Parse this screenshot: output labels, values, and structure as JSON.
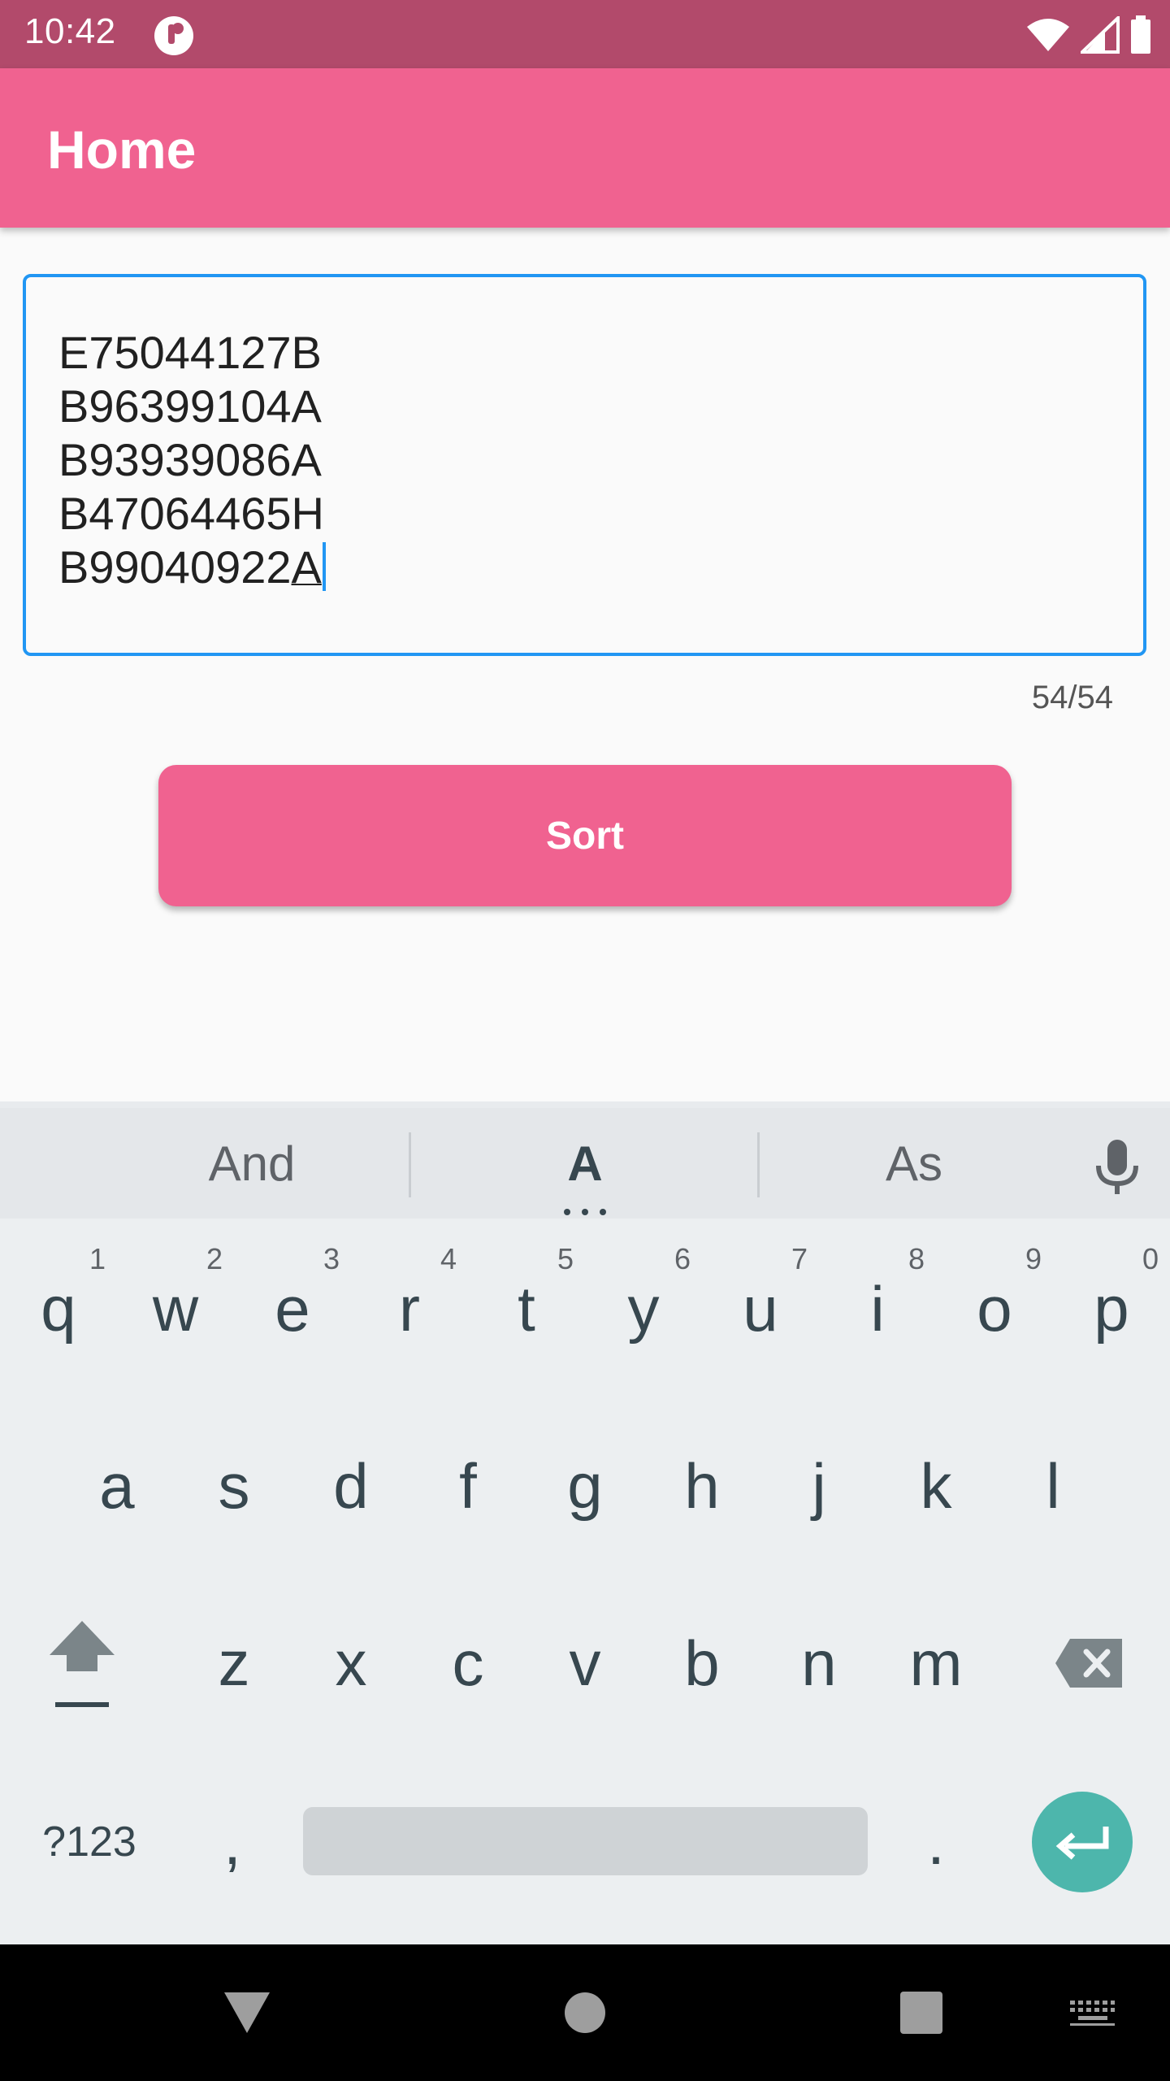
{
  "status_bar": {
    "time": "10:42",
    "icons": [
      "app-notification-icon",
      "wifi-icon",
      "cell-signal-icon",
      "battery-icon"
    ]
  },
  "app_bar": {
    "title": "Home",
    "color": "#f06290"
  },
  "text_field": {
    "lines": [
      "E75044127B",
      "B96399104A",
      "B93939086A",
      "B47064465H",
      "B99040922"
    ],
    "last_char": "A",
    "counter": "54/54",
    "focus_color": "#2196f3"
  },
  "sort_button": {
    "label": "Sort"
  },
  "keyboard": {
    "suggestions": [
      "And",
      "A",
      "As"
    ],
    "row1": [
      {
        "key": "q",
        "num": "1"
      },
      {
        "key": "w",
        "num": "2"
      },
      {
        "key": "e",
        "num": "3"
      },
      {
        "key": "r",
        "num": "4"
      },
      {
        "key": "t",
        "num": "5"
      },
      {
        "key": "y",
        "num": "6"
      },
      {
        "key": "u",
        "num": "7"
      },
      {
        "key": "i",
        "num": "8"
      },
      {
        "key": "o",
        "num": "9"
      },
      {
        "key": "p",
        "num": "0"
      }
    ],
    "row2": [
      "a",
      "s",
      "d",
      "f",
      "g",
      "h",
      "j",
      "k",
      "l"
    ],
    "row3": [
      "z",
      "x",
      "c",
      "v",
      "b",
      "n",
      "m"
    ],
    "symbols_label": "?123",
    "comma": ",",
    "period": ".",
    "icons": [
      "mic-icon",
      "shift-icon",
      "backspace-icon",
      "enter-icon"
    ],
    "enter_color": "#4db6ac"
  },
  "nav_bar": {
    "icons": [
      "back-icon",
      "home-icon",
      "recents-icon",
      "keyboard-switch-icon"
    ]
  }
}
